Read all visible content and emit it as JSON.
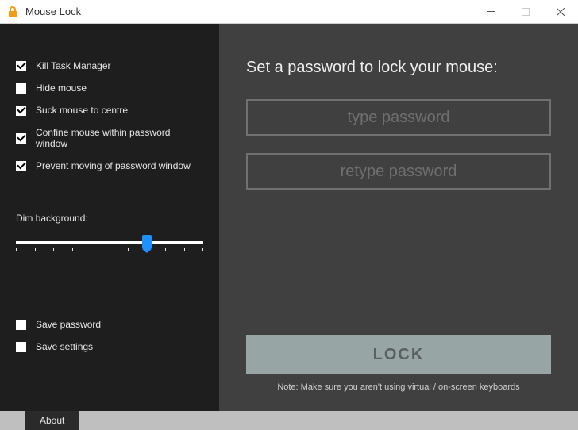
{
  "window": {
    "title": "Mouse Lock"
  },
  "options": {
    "group1": [
      {
        "label": "Kill Task Manager",
        "checked": true
      },
      {
        "label": "Hide mouse",
        "checked": false
      },
      {
        "label": "Suck mouse to centre",
        "checked": true
      },
      {
        "label": "Confine mouse within password window",
        "checked": true
      },
      {
        "label": "Prevent moving of password window",
        "checked": true
      }
    ],
    "dim_label": "Dim background:",
    "dim_value_percent": 70,
    "group2": [
      {
        "label": "Save password",
        "checked": false
      },
      {
        "label": "Save settings",
        "checked": false
      }
    ]
  },
  "main": {
    "heading": "Set a password to lock your mouse:",
    "password_placeholder": "type password",
    "password_confirm_placeholder": "retype password",
    "lock_button": "LOCK",
    "note": "Note: Make sure you aren't using virtual / on-screen keyboards"
  },
  "status": {
    "about": "About"
  }
}
